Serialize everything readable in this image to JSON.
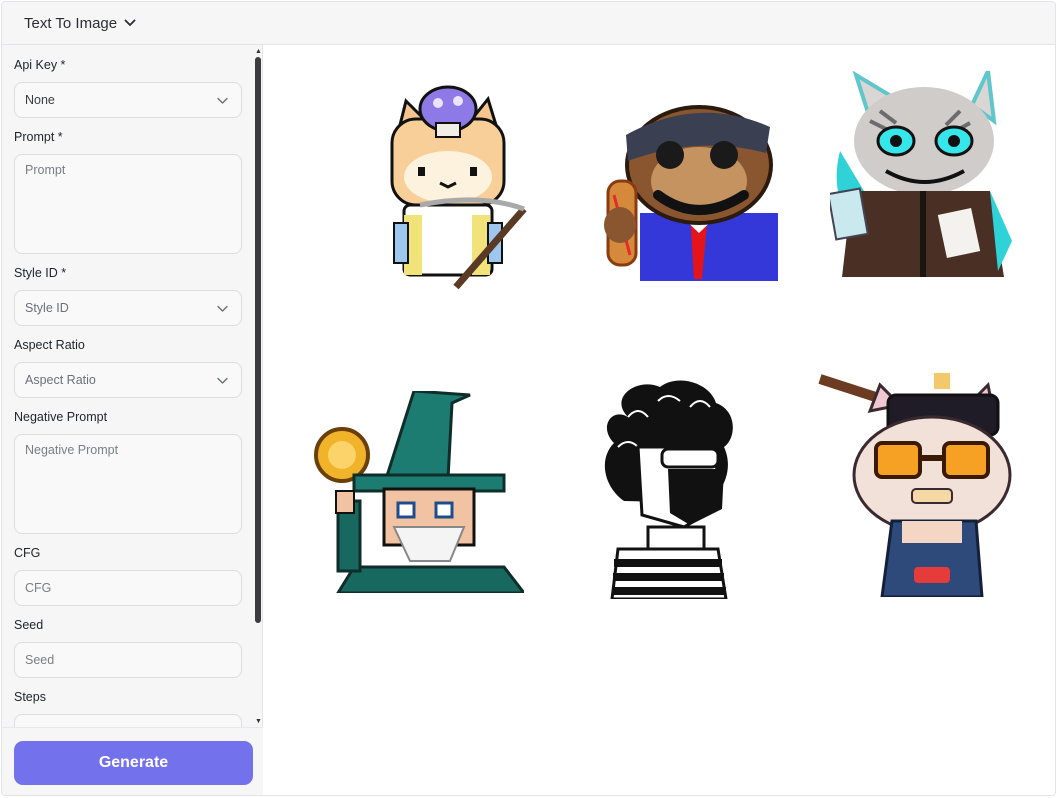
{
  "header": {
    "mode_label": "Text To Image"
  },
  "form": {
    "api_key": {
      "label": "Api Key *",
      "value": "None"
    },
    "prompt": {
      "label": "Prompt *",
      "placeholder": "Prompt"
    },
    "style_id": {
      "label": "Style ID *",
      "placeholder": "Style ID"
    },
    "aspect_ratio": {
      "label": "Aspect Ratio",
      "placeholder": "Aspect Ratio"
    },
    "negative_prompt": {
      "label": "Negative Prompt",
      "placeholder": "Negative Prompt"
    },
    "cfg": {
      "label": "CFG",
      "placeholder": "CFG"
    },
    "seed": {
      "label": "Seed",
      "placeholder": "Seed"
    },
    "steps": {
      "label": "Steps"
    }
  },
  "actions": {
    "generate_label": "Generate"
  },
  "gallery": {
    "items": [
      {
        "subject": "pixel cat with mushroom hat and scythe"
      },
      {
        "subject": "monkey with bandana and hot dog"
      },
      {
        "subject": "cyan striped cat in leather jacket"
      },
      {
        "subject": "pixel wizard with gold coin"
      },
      {
        "subject": "curly-haired figure with mask and striped sweater"
      },
      {
        "subject": "pixel cat with sunglasses and overalls"
      }
    ]
  },
  "colors": {
    "accent": "#7372ec",
    "panel_bg": "#f6f6f7",
    "border": "#e3e4e8"
  }
}
